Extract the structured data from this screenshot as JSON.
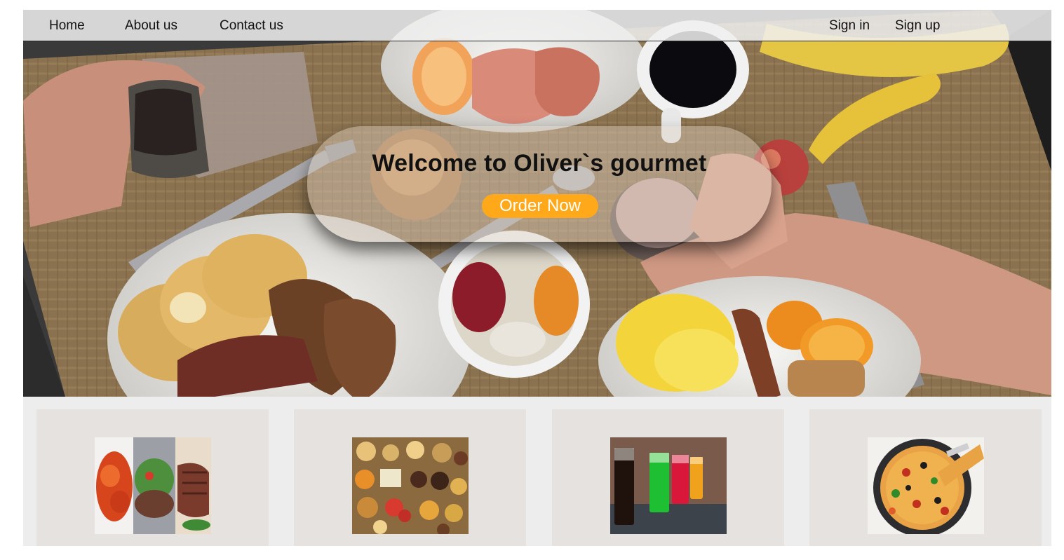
{
  "nav": {
    "links": [
      "Home",
      "About us",
      "Contact us"
    ],
    "auth": [
      "Sign in",
      "Sign up"
    ]
  },
  "hero": {
    "title": "Welcome to Oliver`s gourmet",
    "button_label": "Order Now",
    "button_color": "#ffa91a",
    "background_image": "breakfast-table-photo"
  },
  "cards": [
    {
      "image": "wings-salad-steak-photo"
    },
    {
      "image": "snack-platter-photo"
    },
    {
      "image": "colored-drinks-photo"
    },
    {
      "image": "pizza-photo"
    }
  ]
}
